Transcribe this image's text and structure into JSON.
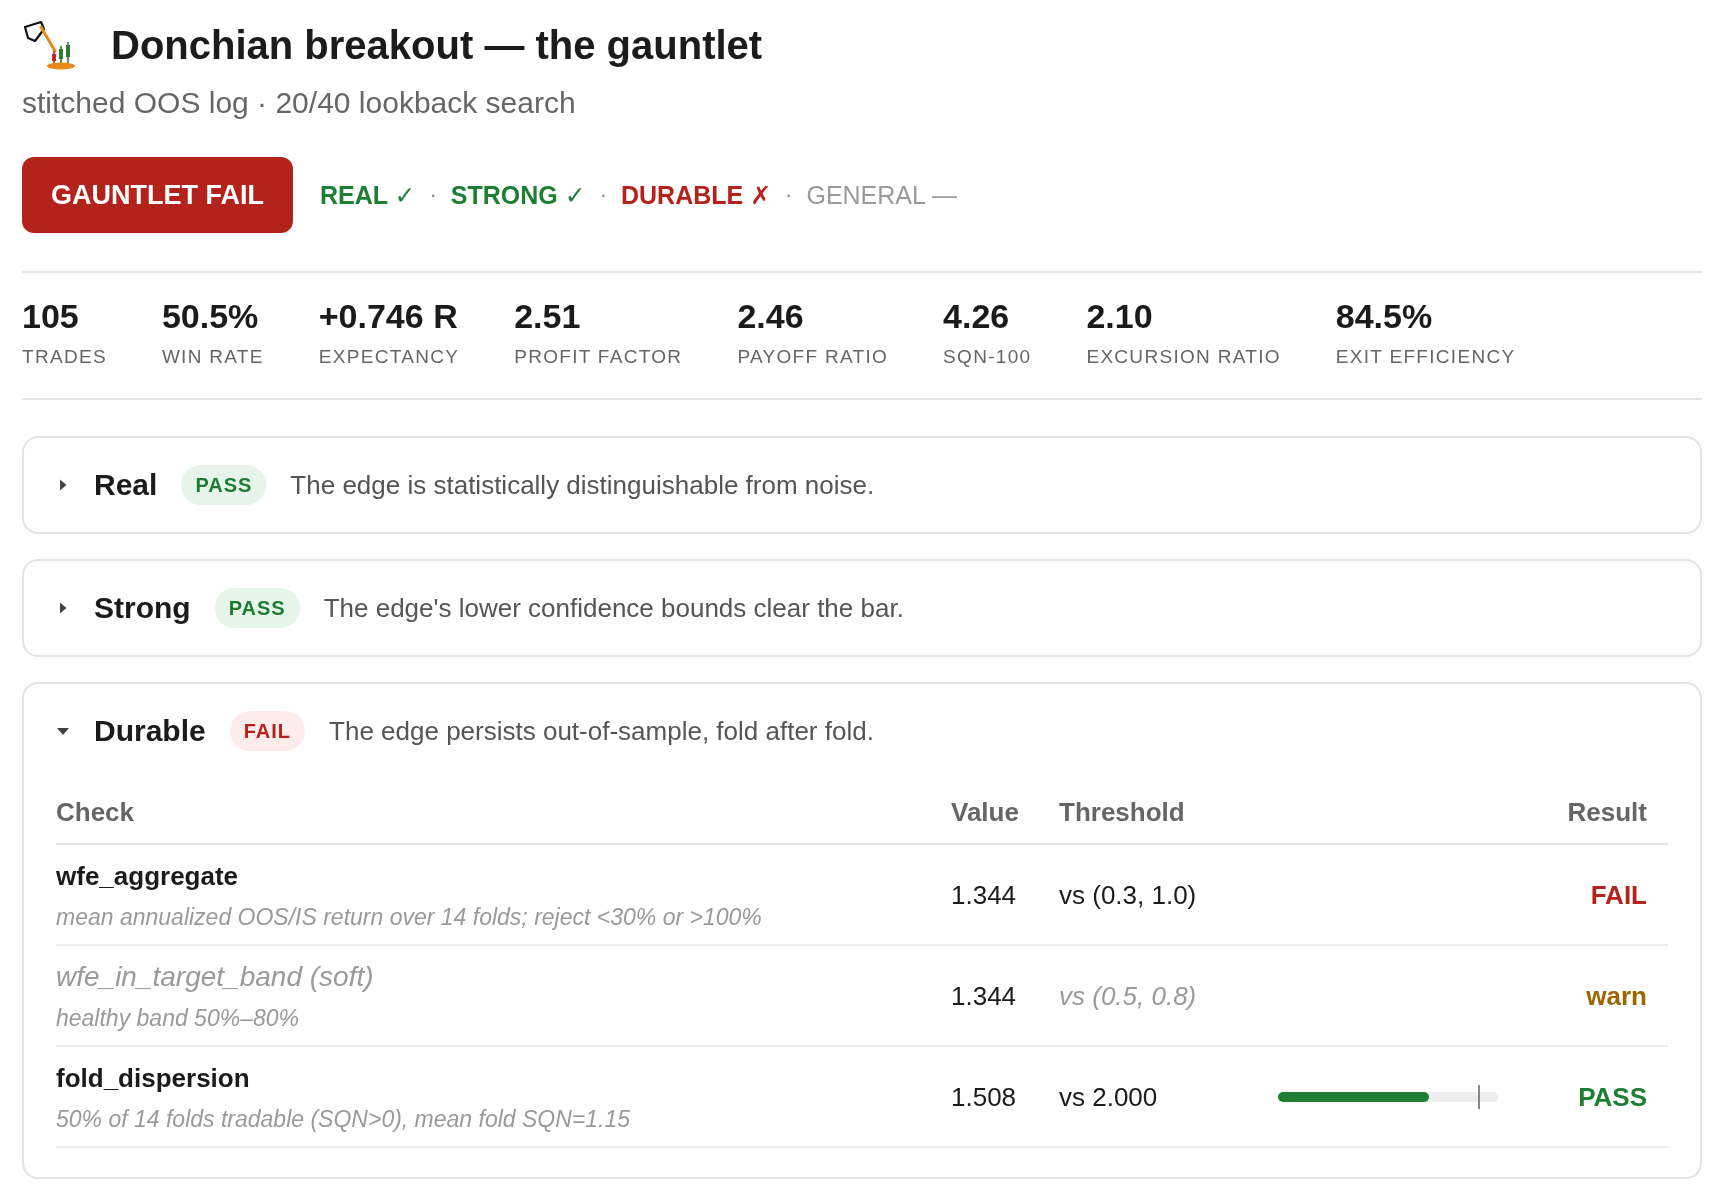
{
  "header": {
    "title": "Donchian breakout — the gauntlet",
    "subtitle": "stitched OOS log · 20/40 lookback search"
  },
  "verdict": {
    "label": "GAUNTLET FAIL",
    "kind": "fail"
  },
  "verdict_strip": [
    {
      "kind": "pass",
      "label": "REAL ✓"
    },
    {
      "kind": "separator",
      "label": "·"
    },
    {
      "kind": "pass",
      "label": "STRONG ✓"
    },
    {
      "kind": "separator",
      "label": "·"
    },
    {
      "kind": "fail",
      "label": "DURABLE ✗"
    },
    {
      "kind": "separator",
      "label": "·"
    },
    {
      "kind": "pending",
      "label": "GENERAL —"
    }
  ],
  "stats": [
    {
      "value": "105",
      "label": "TRADES"
    },
    {
      "value": "50.5%",
      "label": "WIN RATE"
    },
    {
      "value": "+0.746 R",
      "label": "EXPECTANCY"
    },
    {
      "value": "2.51",
      "label": "PROFIT FACTOR"
    },
    {
      "value": "2.46",
      "label": "PAYOFF RATIO"
    },
    {
      "value": "4.26",
      "label": "SQN-100"
    },
    {
      "value": "2.10",
      "label": "EXCURSION RATIO"
    },
    {
      "value": "84.5%",
      "label": "EXIT EFFICIENCY"
    }
  ],
  "gates": [
    {
      "name": "Real",
      "badge": "PASS",
      "kind": "pass",
      "expanded": false,
      "description": "The edge is statistically distinguishable from noise."
    },
    {
      "name": "Strong",
      "badge": "PASS",
      "kind": "pass",
      "expanded": false,
      "description": "The edge's lower confidence bounds clear the bar."
    },
    {
      "name": "Durable",
      "badge": "FAIL",
      "kind": "fail",
      "expanded": true,
      "description": "The edge persists out-of-sample, fold after fold.",
      "table": {
        "columns": [
          "Check",
          "Value",
          "Threshold",
          "Result"
        ],
        "rows": [
          {
            "check": "wfe_aggregate",
            "note": "mean annualized OOS/IS return over 14 folds; reject <30% or >100%",
            "value": "1.344",
            "threshold": "vs (0.3, 1.0)",
            "result": "FAIL",
            "kind": "fail",
            "soft": false
          },
          {
            "check": "wfe_in_target_band (soft)",
            "note": "healthy band 50%–80%",
            "value": "1.344",
            "threshold": "vs (0.5, 0.8)",
            "result": "warn",
            "kind": "warn",
            "soft": true
          },
          {
            "check": "fold_dispersion",
            "note": "50% of 14 folds tradable (SQN>0), mean fold SQN=1.15",
            "value": "1.508",
            "threshold": "vs 2.000",
            "bar": {
              "level": 0.685
            },
            "result": "PASS",
            "kind": "pass",
            "soft": false
          }
        ]
      }
    }
  ]
}
